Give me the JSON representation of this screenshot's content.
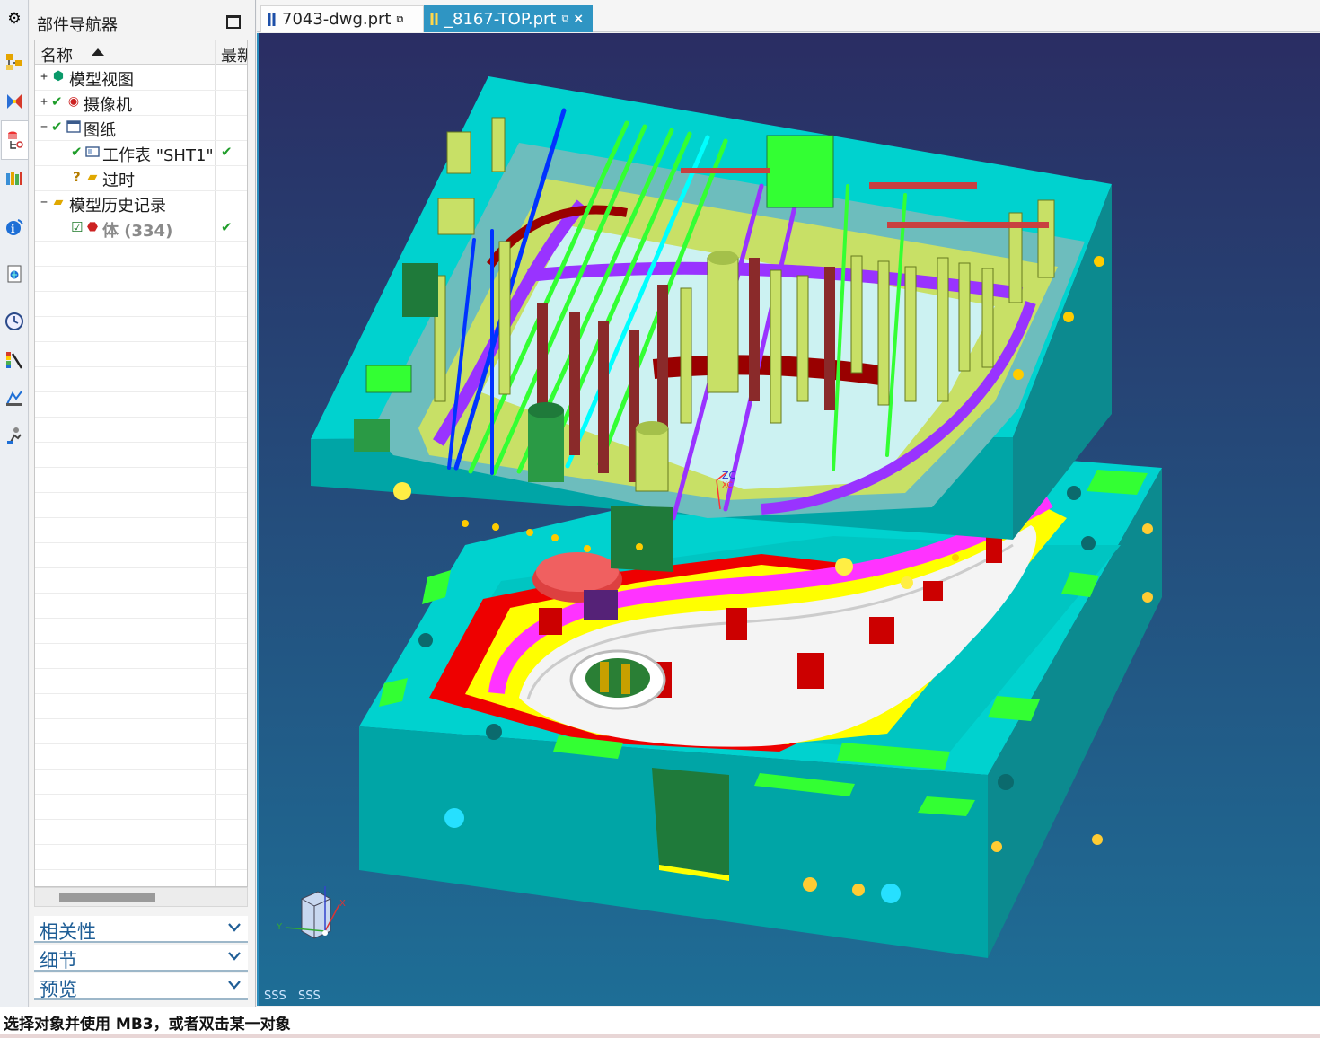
{
  "resource_bar": {
    "icons": [
      "gear-icon",
      "assembly-navigator-icon",
      "constraint-navigator-icon",
      "part-navigator-icon",
      "reuse-library-icon",
      "hd3d-tools-icon",
      "web-browser-icon",
      "history-icon",
      "system-materials-icon",
      "process-studio-icon",
      "roles-icon"
    ]
  },
  "navigator": {
    "title": "部件导航器",
    "columns": {
      "name": "名称",
      "latest": "最新"
    },
    "rows": [
      {
        "expander": "+",
        "check": "",
        "label": "模型视图",
        "latest": ""
      },
      {
        "expander": "+",
        "check": "✔",
        "label": "摄像机",
        "latest": ""
      },
      {
        "expander": "−",
        "check": "✔",
        "label": "图纸",
        "latest": ""
      },
      {
        "expander": "",
        "check": "✔",
        "label": "工作表 \"SHT1\"",
        "latest": "✔"
      },
      {
        "expander": "",
        "check": "?",
        "label": "过时",
        "latest": ""
      },
      {
        "expander": "−",
        "check": "",
        "label": "模型历史记录",
        "latest": ""
      },
      {
        "expander": "",
        "check": "☑",
        "label": "体 (334)",
        "latest": "✔"
      }
    ],
    "panels": [
      "相关性",
      "细节",
      "预览"
    ]
  },
  "tabs": [
    {
      "label": "7043-dwg.prt",
      "ext_icon": "⧉",
      "active": false
    },
    {
      "label": "_8167-TOP.prt",
      "ext_icon": "⧉",
      "close": "×",
      "active": true
    }
  ],
  "viewport": {
    "overlay_left": "SSS",
    "overlay_right": "SSS",
    "csys_label_zc": "ZC",
    "csys_label_xc": "XC",
    "triad_x": "X",
    "triad_y": "Y",
    "colors": {
      "bg_top": "#2a2d63",
      "bg_bottom": "#1e6e96",
      "plate": "#00d2cf",
      "plate_dark": "#00a5a6",
      "plate_side": "#0c8a8f",
      "yellow": "#ffff00",
      "green": "#33ff33",
      "magenta": "#ff33ff",
      "red": "#ee0000",
      "purple": "#9933ff",
      "blue": "#0033ff",
      "olive": "#c8e066",
      "pale": "#d8ffff"
    }
  },
  "status": {
    "message": "选择对象并使用 MB3，或者双击某一对象"
  }
}
